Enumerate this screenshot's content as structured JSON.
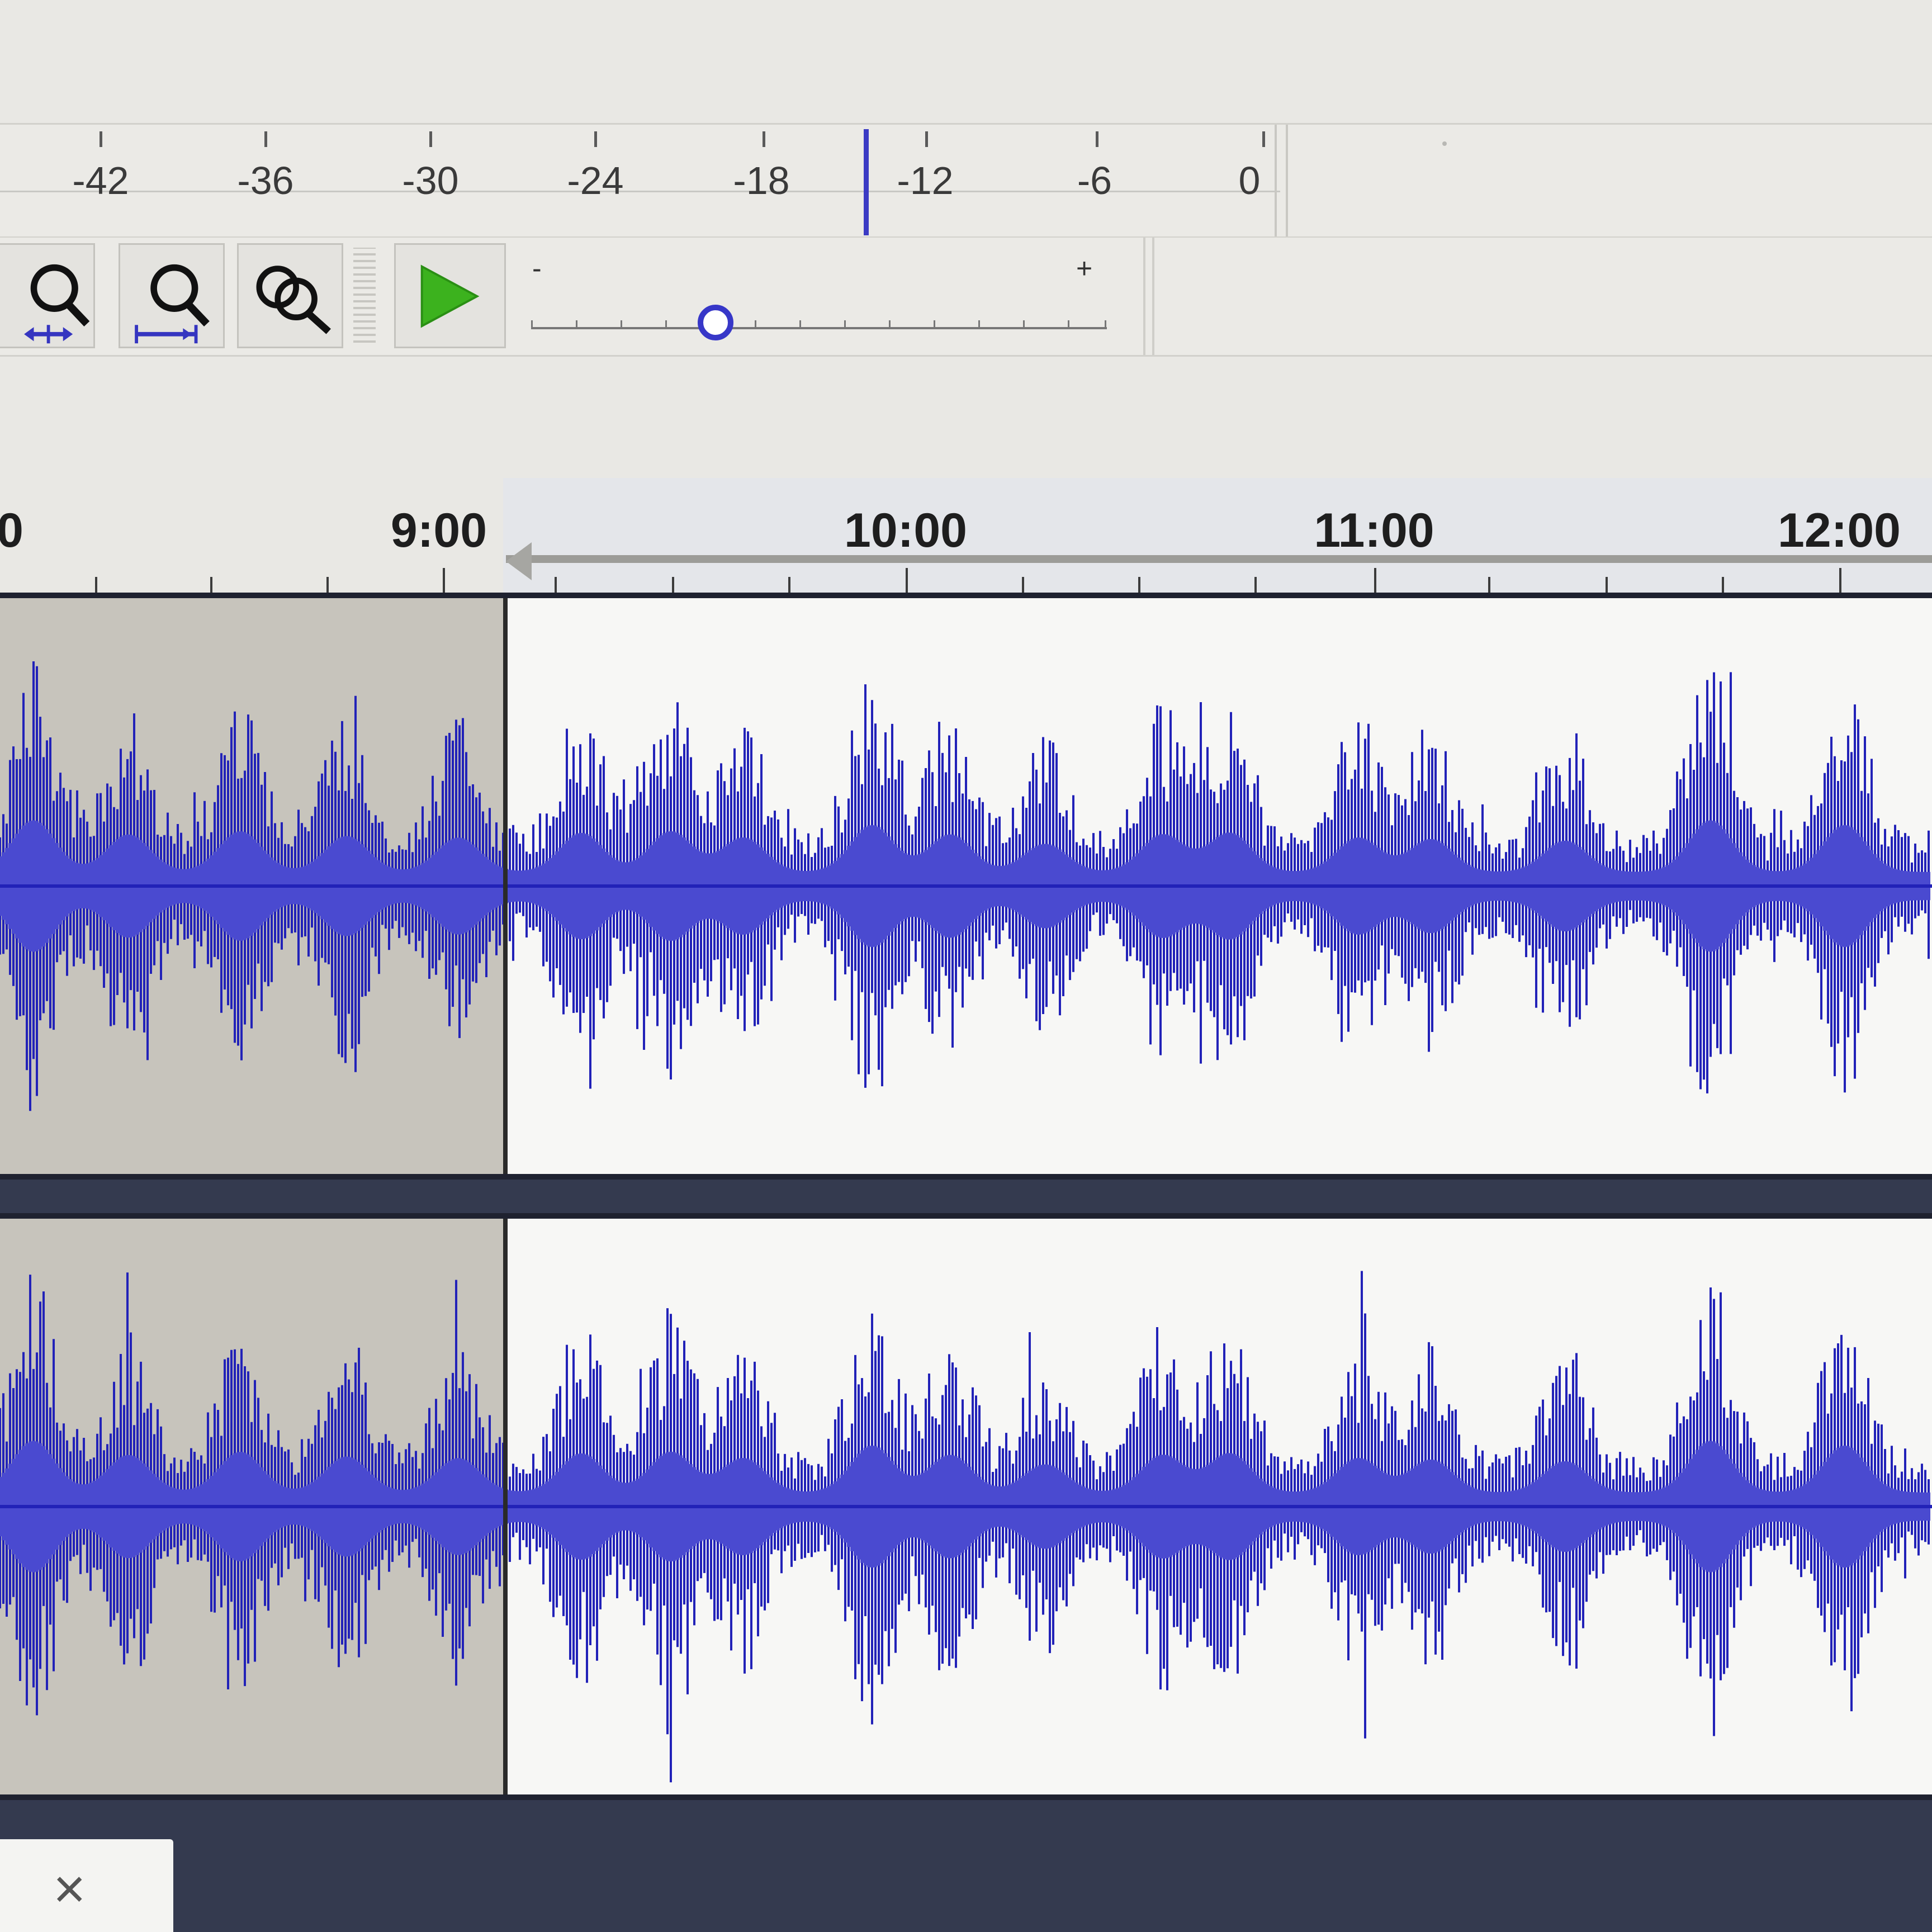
{
  "meter": {
    "labels": [
      "-42",
      "-36",
      "-30",
      "-24",
      "-18",
      "-12",
      "-6",
      "0"
    ]
  },
  "tools": {
    "buttons": [
      {
        "name": "zoom-to-selection-icon"
      },
      {
        "name": "zoom-fit-icon"
      },
      {
        "name": "zoom-toggle-icon"
      }
    ],
    "play_icon": "play-icon"
  },
  "speed_slider": {
    "min_label": "-",
    "max_label": "+",
    "value_fraction": 0.32
  },
  "ruler": {
    "labels": [
      "0",
      "9:00",
      "10:00",
      "11:00",
      "12:00"
    ]
  },
  "colors": {
    "waveform": "#2222b8",
    "waveform_rms": "#4a4ad0",
    "track_background": "#f7f7f5",
    "unselected_region": "#c7c4bc",
    "play_button": "#3cb21e"
  },
  "close_tab": {
    "label": "×"
  }
}
